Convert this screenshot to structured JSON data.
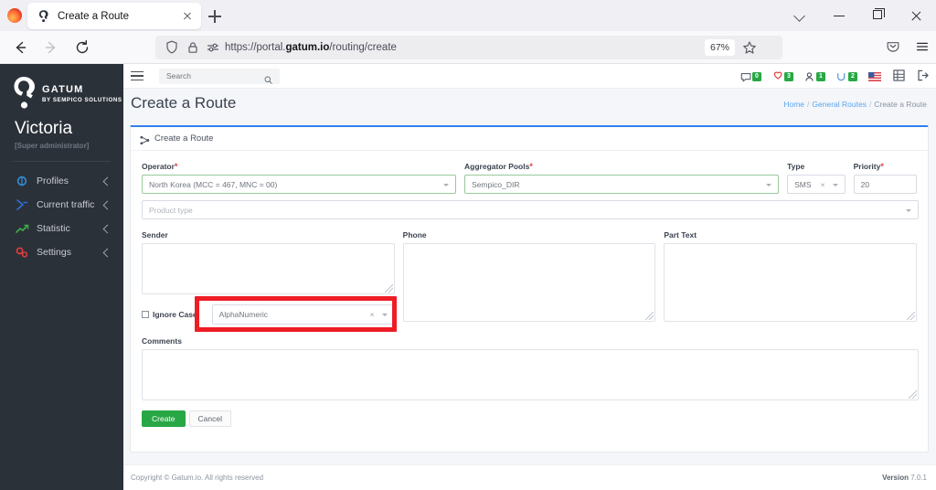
{
  "browser": {
    "tab_title": "Create a Route",
    "tab_favicon_icon": "gatum-logo-icon",
    "url_prefix": "https://portal.",
    "url_domain": "gatum.io",
    "url_suffix": "/routing/create",
    "zoom_level": "67%",
    "icons": {
      "back": "back-arrow-icon",
      "forward": "forward-arrow-icon",
      "reload": "reload-icon",
      "shield": "shield-icon",
      "lock": "lock-icon",
      "permissions": "page-permissions-icon",
      "bookmark": "star-icon",
      "pocket": "pocket-icon",
      "menu": "hamburger-menu-icon",
      "newtab": "new-tab-icon",
      "close_tab": "close-icon",
      "list_all_tabs": "chevron-down-icon",
      "minimize": "minimize-icon",
      "maximize": "maximize-icon",
      "close_window": "close-window-icon"
    }
  },
  "sidebar": {
    "brand_name": "GATUM",
    "brand_sub": "BY SEMPICO SOLUTIONS",
    "user_name": "Victoria",
    "user_role": "[Super administrator]",
    "items": [
      {
        "label": "Profiles",
        "icon": "profiles-icon"
      },
      {
        "label": "Current traffic",
        "icon": "current-traffic-icon"
      },
      {
        "label": "Statistic",
        "icon": "statistic-icon"
      },
      {
        "label": "Settings",
        "icon": "settings-gear-icon"
      }
    ]
  },
  "topbar": {
    "search_placeholder": "Search",
    "search_value": "",
    "icons": [
      {
        "name": "messages-icon",
        "badge": "0"
      },
      {
        "name": "alerts-icon",
        "badge": "3"
      },
      {
        "name": "users-icon",
        "badge": "1"
      },
      {
        "name": "connections-icon",
        "badge": "2"
      }
    ],
    "flag_icon": "us-flag-icon",
    "grid_icon": "apps-grid-icon",
    "logout_icon": "logout-icon"
  },
  "page": {
    "title": "Create a Route",
    "breadcrumb": [
      {
        "label": "Home",
        "link": true
      },
      {
        "label": "General Routes",
        "link": true
      },
      {
        "label": "Create a Route",
        "link": false
      }
    ],
    "breadcrumb_separator": "/"
  },
  "card": {
    "header_title": "Create a Route",
    "header_icon": "route-sitemap-icon",
    "fields": {
      "operator": {
        "label": "Operator",
        "required": "*",
        "value": "North Korea (MCC = 467, MNC = 00)"
      },
      "aggregator_pools": {
        "label": "Aggregator Pools",
        "required": "*",
        "value": "Sempico_DIR"
      },
      "type": {
        "label": "Type",
        "required": "",
        "value": "SMS",
        "clear": "×"
      },
      "priority": {
        "label": "Priority",
        "required": "*",
        "value": "20"
      },
      "product_type": {
        "label": "",
        "placeholder": "Product type",
        "value": ""
      },
      "sender": {
        "label": "Sender",
        "value": ""
      },
      "phone": {
        "label": "Phone",
        "value": ""
      },
      "part_text": {
        "label": "Part Text",
        "value": ""
      },
      "ignore_case": {
        "label": "Ignore Case",
        "checked": false
      },
      "alphanumeric": {
        "value": "AlphaNumeric",
        "clear": "×"
      },
      "comments": {
        "label": "Comments",
        "value": ""
      }
    },
    "buttons": {
      "create": "Create",
      "cancel": "Cancel"
    }
  },
  "highlight": {
    "color": "#ee1c25",
    "target": "alphanumeric-select"
  },
  "footer": {
    "copyright": "Copyright © Gatum.io. All rights reserved",
    "version_label": "Version",
    "version_value": "7.0.1"
  }
}
